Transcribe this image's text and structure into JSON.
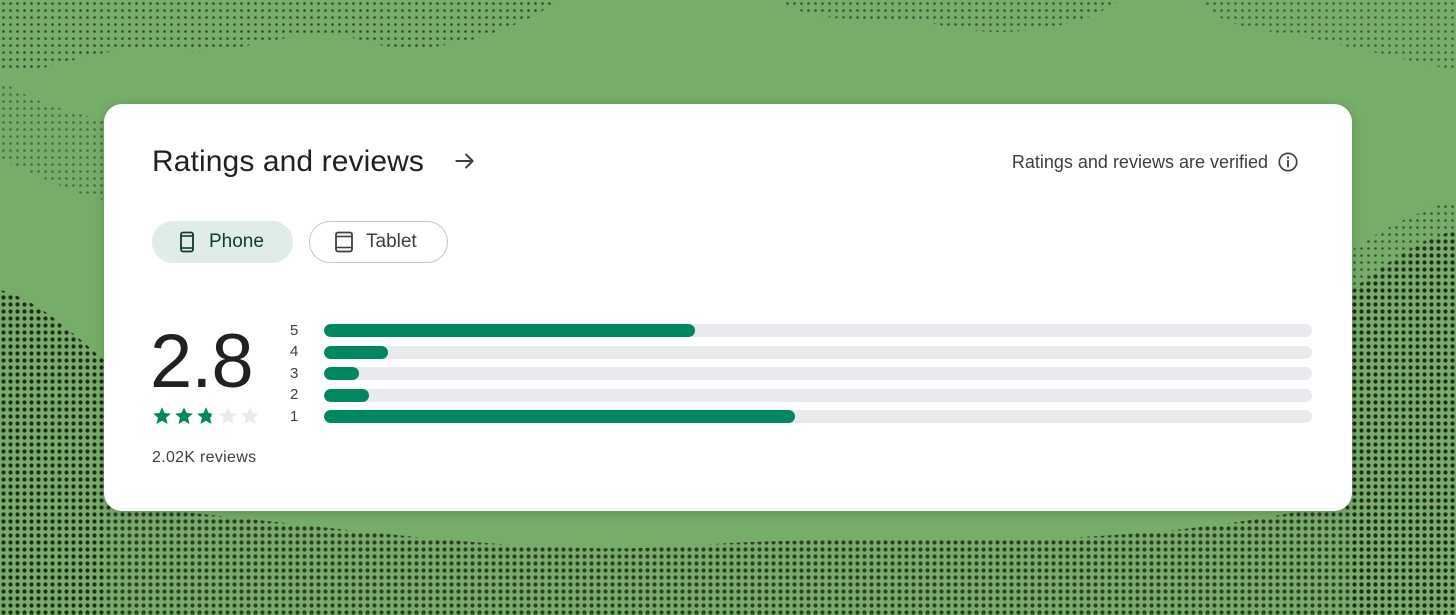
{
  "header": {
    "title": "Ratings and reviews",
    "verified_text": "Ratings and reviews are verified",
    "arrow_icon": "arrow-right-icon",
    "info_icon": "info-icon"
  },
  "device_tabs": [
    {
      "label": "Phone",
      "icon": "phone-icon",
      "selected": true
    },
    {
      "label": "Tablet",
      "icon": "tablet-icon",
      "selected": false
    }
  ],
  "summary": {
    "score": "2.8",
    "star_rating": 2.8,
    "star_max": 5,
    "reviews": "2.02K reviews"
  },
  "distribution": [
    {
      "stars": "5",
      "fraction": 0.375
    },
    {
      "stars": "4",
      "fraction": 0.065
    },
    {
      "stars": "3",
      "fraction": 0.035
    },
    {
      "stars": "2",
      "fraction": 0.046
    },
    {
      "stars": "1",
      "fraction": 0.477
    }
  ],
  "colors": {
    "accent": "#01875f",
    "track": "#e8eaed",
    "chip_selected_bg": "#e0ece6",
    "background": "#76ad69"
  }
}
